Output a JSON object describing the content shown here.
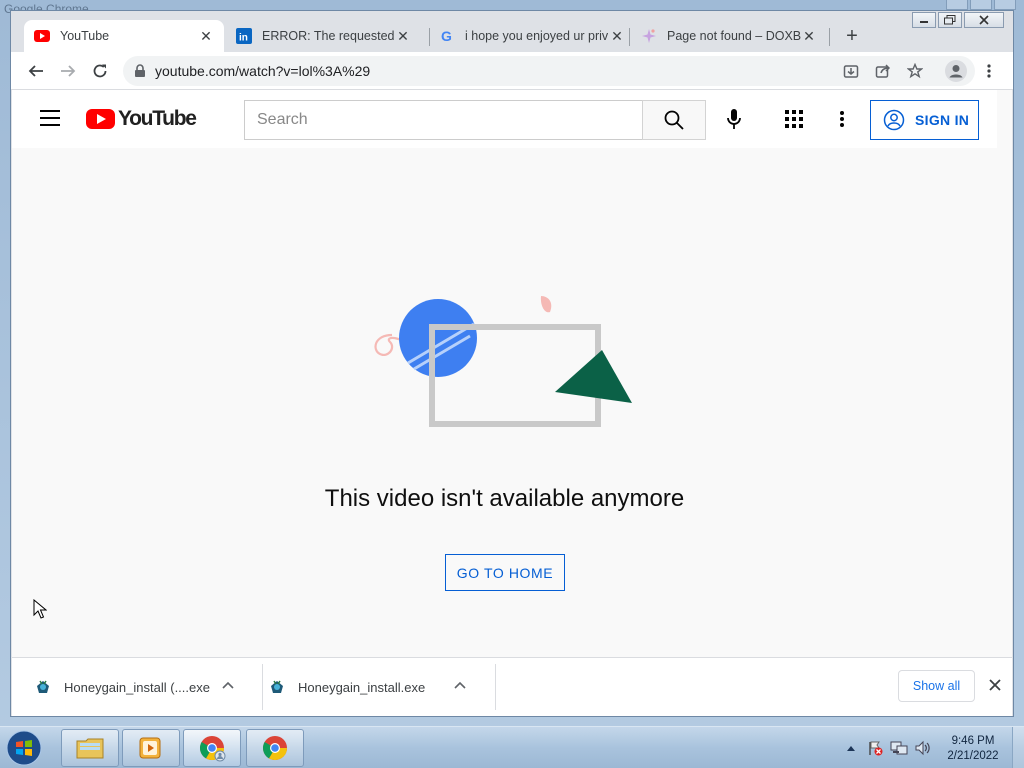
{
  "os": {
    "window_title": "Google Chrome"
  },
  "browser": {
    "tabs": [
      {
        "title": "YouTube",
        "favicon": "youtube-favicon",
        "active": true
      },
      {
        "title": "ERROR: The requested UR",
        "favicon": "linkedin-favicon",
        "active": false
      },
      {
        "title": "i hope you enjoyed ur priv",
        "favicon": "google-favicon",
        "active": false
      },
      {
        "title": "Page not found – DOXBO",
        "favicon": "sparkle-favicon",
        "active": false
      }
    ],
    "new_tab_label": "+",
    "url": "youtube.com/watch?v=lol%3A%29"
  },
  "youtube": {
    "search_placeholder": "Search",
    "sign_in_label": "SIGN IN",
    "message": "This video isn't available anymore",
    "home_button_label": "GO TO HOME",
    "colors": {
      "brand_red": "#ff0000",
      "link_blue": "#065fd4",
      "illustration_blue": "#3e7ff1",
      "illustration_green": "#0b6147",
      "illustration_pink": "#f5b9b5"
    }
  },
  "downloads": {
    "items": [
      {
        "name": "Honeygain_install (....exe",
        "icon": "honeygain-icon"
      },
      {
        "name": "Honeygain_install.exe",
        "icon": "honeygain-icon"
      }
    ],
    "show_all_label": "Show all"
  },
  "taskbar": {
    "time": "9:46 PM",
    "date": "2/21/2022"
  }
}
